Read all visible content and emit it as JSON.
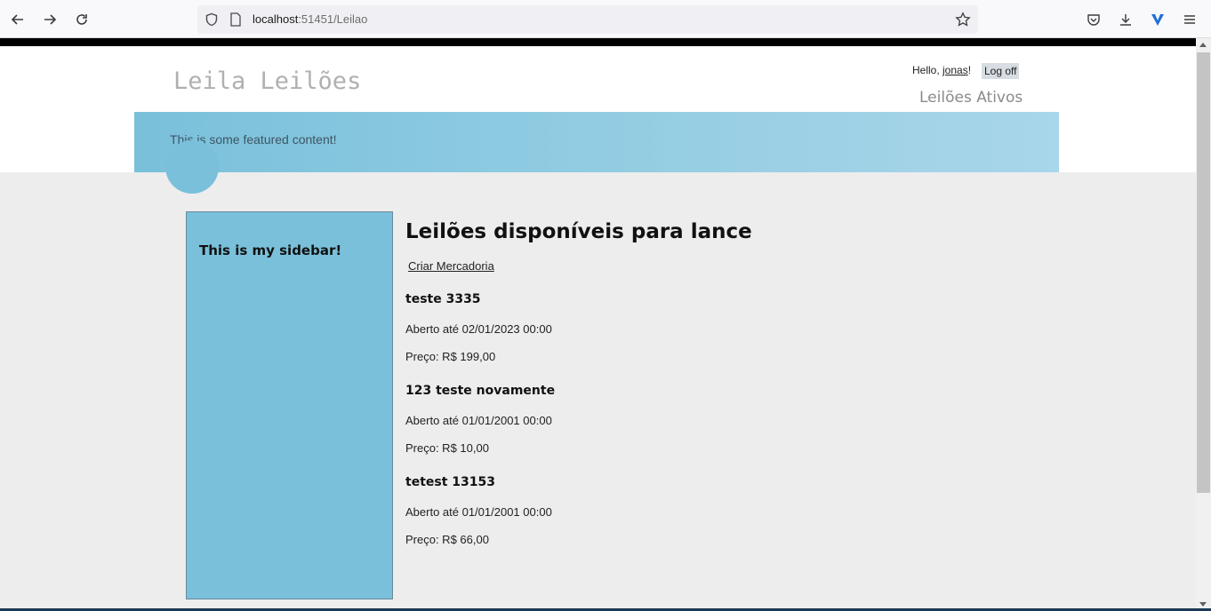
{
  "browser": {
    "url_host": "localhost",
    "url_path": ":51451/Leilao",
    "icons": [
      "back-icon",
      "forward-icon",
      "reload-icon",
      "shield-icon",
      "page-icon",
      "bookmark-star-icon",
      "pocket-icon",
      "download-icon",
      "extension-icon",
      "menu-icon"
    ]
  },
  "header": {
    "site_title": "Leila Leilões",
    "hello_prefix": "Hello, ",
    "username": "jonas",
    "hello_suffix": "!",
    "logoff_label": "Log off",
    "nav_active": "Leilões Ativos"
  },
  "featured": {
    "text": "This is some featured content!"
  },
  "sidebar": {
    "title": "This is my sidebar!"
  },
  "main": {
    "heading": "Leilões disponíveis para lance",
    "create_link": "Criar Mercadoria",
    "items": [
      {
        "title": "teste 3335",
        "date": "Aberto até 02/01/2023 00:00",
        "price": "Preço: R$ 199,00"
      },
      {
        "title": "123 teste novamente",
        "date": "Aberto até 01/01/2001 00:00",
        "price": "Preço: R$ 10,00"
      },
      {
        "title": "tetest 13153",
        "date": "Aberto até 01/01/2001 00:00",
        "price": "Preço: R$ 66,00"
      }
    ]
  }
}
